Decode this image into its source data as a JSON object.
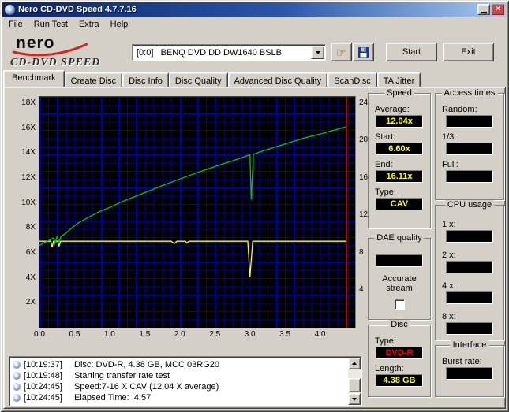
{
  "window": {
    "title": "Nero CD-DVD Speed 4.7.7.16"
  },
  "menu": {
    "items": [
      "File",
      "Run Test",
      "Extra",
      "Help"
    ]
  },
  "toolbar": {
    "logo_brand": "nero",
    "logo_product": "CD-DVD SPEED",
    "drive_select": "[0:0]   BENQ DVD DD DW1640 BSLB",
    "start_label": "Start",
    "exit_label": "Exit"
  },
  "tabs": {
    "active": "Benchmark",
    "items": [
      "Benchmark",
      "Create Disc",
      "Disc Info",
      "Disc Quality",
      "Advanced Disc Quality",
      "ScanDisc",
      "TA Jitter"
    ]
  },
  "chart_data": {
    "type": "line",
    "x_axis": {
      "unit": "GB",
      "ticks": [
        0,
        0.5,
        1.0,
        1.5,
        2.0,
        2.5,
        3.0,
        3.5,
        4.0
      ],
      "plot_max": 4.5
    },
    "y_left": {
      "suffix": "X",
      "ticks": [
        18,
        16,
        14,
        12,
        10,
        8,
        6,
        4,
        2
      ],
      "plot_max": 18.5
    },
    "y_right": {
      "ticks": [
        24,
        20,
        16,
        12,
        8,
        4
      ],
      "plot_max": 24.65
    },
    "grid_color": "#0000b4",
    "series": [
      {
        "name": "rotation-speed",
        "color": "#ffff00",
        "points": [
          [
            0,
            6.93
          ],
          [
            0.16,
            6.93
          ],
          [
            0.18,
            6.45
          ],
          [
            0.2,
            6.93
          ],
          [
            0.26,
            6.93
          ],
          [
            0.28,
            6.55
          ],
          [
            0.3,
            6.93
          ],
          [
            1.88,
            6.93
          ],
          [
            1.92,
            6.75
          ],
          [
            1.96,
            6.93
          ],
          [
            2.08,
            6.93
          ],
          [
            2.1,
            6.8
          ],
          [
            2.13,
            6.93
          ],
          [
            2.97,
            6.93
          ],
          [
            3.0,
            4.05
          ],
          [
            3.04,
            6.93
          ],
          [
            4.38,
            6.93
          ]
        ]
      },
      {
        "name": "read-speed",
        "color": "#00cc00",
        "points": [
          [
            0,
            6.6
          ],
          [
            0.06,
            6.8
          ],
          [
            0.12,
            6.95
          ],
          [
            0.17,
            7.1
          ],
          [
            0.2,
            7.2
          ],
          [
            0.22,
            6.75
          ],
          [
            0.25,
            7.3
          ],
          [
            0.28,
            6.9
          ],
          [
            0.31,
            7.35
          ],
          [
            0.36,
            7.5
          ],
          [
            0.45,
            7.95
          ],
          [
            0.55,
            8.4
          ],
          [
            0.7,
            8.85
          ],
          [
            0.85,
            9.3
          ],
          [
            1.0,
            9.64
          ],
          [
            1.2,
            10.15
          ],
          [
            1.4,
            10.6
          ],
          [
            1.6,
            11.05
          ],
          [
            1.8,
            11.5
          ],
          [
            2.0,
            11.92
          ],
          [
            2.2,
            12.33
          ],
          [
            2.4,
            12.72
          ],
          [
            2.6,
            13.1
          ],
          [
            2.8,
            13.47
          ],
          [
            2.97,
            13.8
          ],
          [
            3.0,
            13.84
          ],
          [
            3.02,
            10.3
          ],
          [
            3.05,
            13.9
          ],
          [
            3.2,
            14.2
          ],
          [
            3.4,
            14.55
          ],
          [
            3.6,
            14.9
          ],
          [
            3.8,
            15.25
          ],
          [
            4.0,
            15.52
          ],
          [
            4.2,
            15.83
          ],
          [
            4.38,
            16.11
          ]
        ]
      }
    ],
    "end_marker": {
      "x": 4.38,
      "color": "#b00000"
    }
  },
  "panels": {
    "speed": {
      "title": "Speed",
      "value_color": "#ffff00",
      "fields": [
        {
          "label": "Average:",
          "value": "12.04x"
        },
        {
          "label": "Start:",
          "value": "6.60x"
        },
        {
          "label": "End:",
          "value": "16.11x"
        },
        {
          "label": "Type:",
          "value": "CAV"
        }
      ]
    },
    "access": {
      "title": "Access times",
      "fields": [
        {
          "label": "Random:",
          "value": ""
        },
        {
          "label": "1/3:",
          "value": ""
        },
        {
          "label": "Full:",
          "value": ""
        }
      ]
    },
    "cpu": {
      "title": "CPU usage",
      "fields": [
        {
          "label": "1 x:",
          "value": ""
        },
        {
          "label": "2 x:",
          "value": ""
        },
        {
          "label": "4 x:",
          "value": ""
        },
        {
          "label": "8 x:",
          "value": ""
        }
      ]
    },
    "dae": {
      "title": "DAE quality",
      "value": "",
      "checkbox_label": "Accurate stream",
      "checked": false
    },
    "disc": {
      "title": "Disc",
      "fields": [
        {
          "label": "Type:",
          "value": "DVD-R",
          "value_color": "#ff0000"
        },
        {
          "label": "Length:",
          "value": "4.38 GB",
          "value_color": "#ffff00"
        }
      ]
    },
    "interface": {
      "title": "Interface",
      "fields": [
        {
          "label": "Burst rate:",
          "value": ""
        }
      ]
    }
  },
  "log": {
    "lines": [
      {
        "time": "[10:19:37]",
        "text": "Disc: DVD-R, 4.38 GB, MCC 03RG20"
      },
      {
        "time": "[10:19:48]",
        "text": "Starting transfer rate test"
      },
      {
        "time": "[10:24:45]",
        "text": "Speed:7-16 X CAV (12.04 X average)"
      },
      {
        "time": "[10:24:45]",
        "text": "Elapsed Time:  4:57"
      }
    ]
  }
}
